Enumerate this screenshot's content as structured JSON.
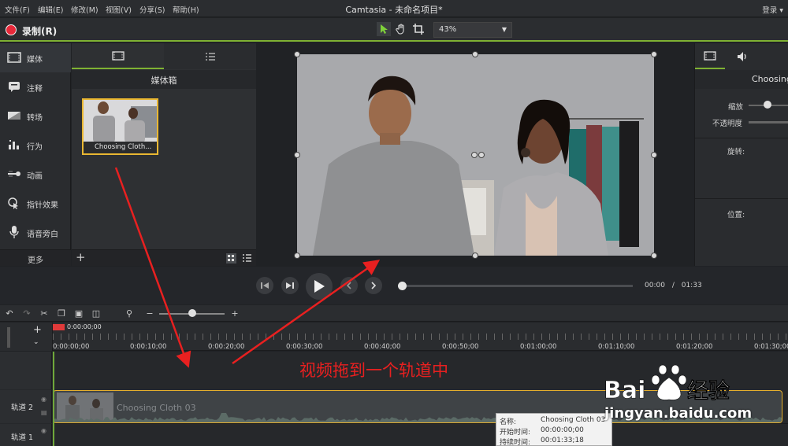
{
  "menu": {
    "items": [
      "文件(F)",
      "编辑(E)",
      "修改(M)",
      "视图(V)",
      "分享(S)",
      "帮助(H)"
    ],
    "title": "Camtasia - 未命名项目*",
    "login": "登录 ▾"
  },
  "toolbar": {
    "record_label": "录制(R)",
    "zoom_value": "43%",
    "icons": [
      "pointer-icon",
      "hand-icon",
      "crop-icon"
    ],
    "accent_color": "#7fb233",
    "record_color": "#e8283a"
  },
  "sidebar": {
    "items": [
      {
        "label": "媒体",
        "icon": "film-icon"
      },
      {
        "label": "注释",
        "icon": "annotation-icon"
      },
      {
        "label": "转场",
        "icon": "transition-icon"
      },
      {
        "label": "行为",
        "icon": "behavior-icon"
      },
      {
        "label": "动画",
        "icon": "animation-icon"
      },
      {
        "label": "指针效果",
        "icon": "cursor-effect-icon"
      },
      {
        "label": "语音旁白",
        "icon": "microphone-icon"
      }
    ],
    "more_label": "更多"
  },
  "media_bin": {
    "title": "媒体箱",
    "clip_name": "Choosing Cloth..."
  },
  "properties": {
    "title": "Choosing",
    "scale_label": "缩放",
    "opacity_label": "不透明度",
    "rotation_label": "旋转:",
    "position_label": "位置:"
  },
  "player": {
    "current_time": "00:00",
    "separator": "/",
    "total_time": "01:33"
  },
  "timeline": {
    "playhead_time": "0:00:00;00",
    "ticks": [
      "0:00:00;00",
      "0:00:10;00",
      "0:00:20;00",
      "0:00:30;00",
      "0:00:40;00",
      "0:00:50;00",
      "0:01:00;00",
      "0:01:10;00",
      "0:01:20;00",
      "0:01:30;00"
    ],
    "tracks": [
      {
        "name": "轨道 2",
        "clip": "Choosing Cloth 03"
      },
      {
        "name": "轨道 1"
      }
    ]
  },
  "tooltip": {
    "name_label": "名称:",
    "name_value": "Choosing Cloth 03",
    "start_label": "开始时间:",
    "start_value": "00:00:00;00",
    "duration_label": "持续时间:",
    "duration_value": "00:01:33;18"
  },
  "annotation": {
    "text": "视频拖到一个轨道中",
    "color": "#e82020"
  },
  "watermark": {
    "brand": "Baidu经验",
    "url": "jingyan.baidu.com"
  }
}
